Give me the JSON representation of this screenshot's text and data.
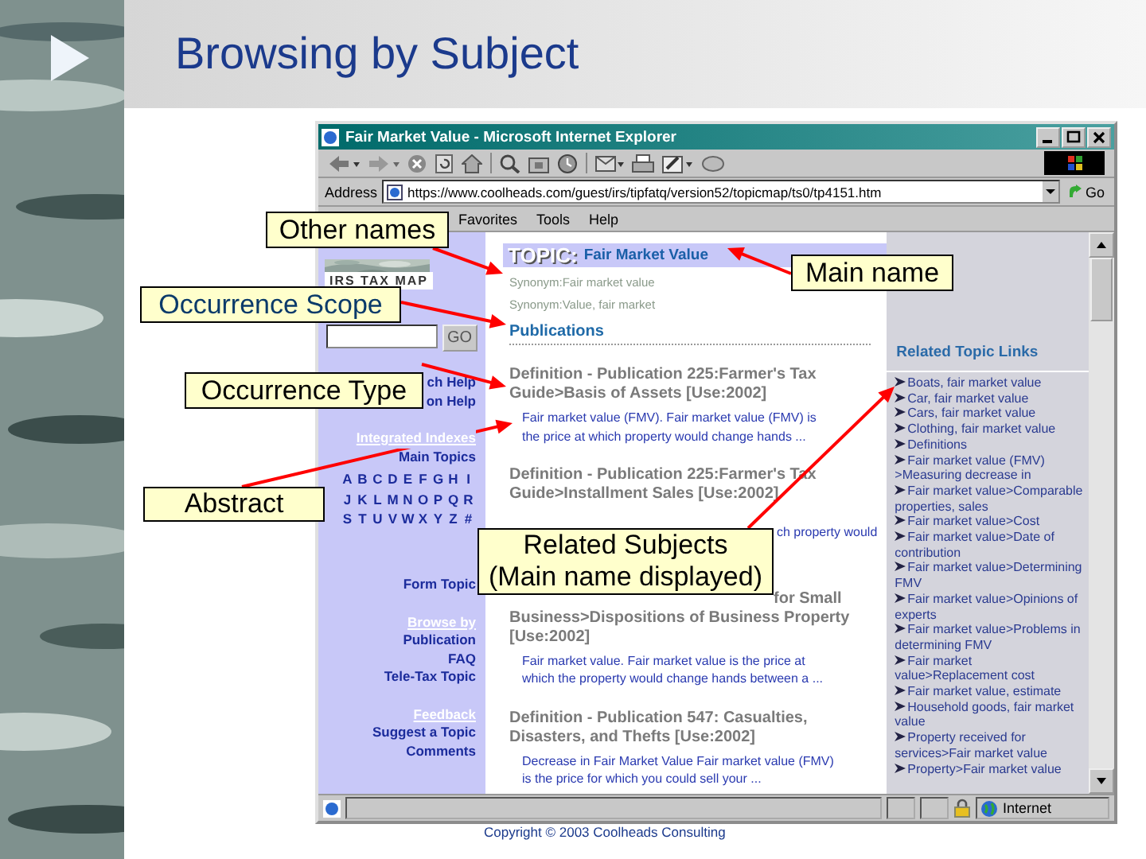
{
  "slide": {
    "title": "Browsing by Subject",
    "copyright": "Copyright © 2003 Coolheads Consulting"
  },
  "browser": {
    "title": "Fair Market Value - Microsoft Internet Explorer",
    "address_label": "Address",
    "url": "https://www.coolheads.com/guest/irs/tipfatq/version52/topicmap/ts0/tp4151.htm",
    "go": "Go",
    "menu": [
      "Favorites",
      "Tools",
      "Help"
    ],
    "status": "Internet"
  },
  "sidebar": {
    "logo_text": "IRS TAX MAP",
    "search_button": "GO",
    "help_links": [
      "ch Help",
      "on Help"
    ],
    "indexes_heading": "Integrated Indexes",
    "main_topics": "Main Topics",
    "letters": [
      "A",
      "B",
      "C",
      "D",
      "E",
      "F",
      "G",
      "H",
      "I",
      "J",
      "K",
      "L",
      "M",
      "N",
      "O",
      "P",
      "Q",
      "R",
      "S",
      "T",
      "U",
      "V",
      "W",
      "X",
      "Y",
      "Z",
      "#"
    ],
    "form_topic": "Form Topic",
    "browse_heading": "Browse by",
    "browse_links": [
      "Publication",
      "FAQ",
      "Tele-Tax Topic"
    ],
    "feedback_heading": "Feedback",
    "feedback_links": [
      "Suggest a Topic",
      "Comments"
    ]
  },
  "topic": {
    "label": "TOPIC:",
    "name": "Fair Market Value",
    "synonyms": [
      "Synonym:Fair market value",
      "Synonym:Value, fair market"
    ],
    "section": "Publications",
    "entries": [
      {
        "title": "Definition - Publication 225:Farmer's Tax Guide>Basis of Assets [Use:2002]",
        "abstract": "Fair market value (FMV). Fair market value (FMV) is the price at which property would change hands ...",
        "kind": "plain"
      },
      {
        "title": "Definition - Publication 225:Farmer's Tax Guide>Installment Sales [Use:2002]",
        "abstract": "ch property would",
        "kind": "partialabstract"
      },
      {
        "title": "for Small Business>Dispositions of Business Property [Use:2002]",
        "abstract": "Fair market value. Fair market value is the price at which the property would change hands between a ...",
        "kind": "partialtitle"
      },
      {
        "title": "Definition - Publication 547: Casualties, Disasters, and Thefts [Use:2002]",
        "abstract": "Decrease in Fair Market Value Fair market value (FMV) is the price for which you could sell your ...",
        "kind": "plain"
      }
    ]
  },
  "related": {
    "heading": "Related Topic Links",
    "links": [
      "Boats, fair market value",
      "Car, fair market value",
      "Cars, fair market value",
      "Clothing, fair market value",
      "Definitions",
      "Fair market value (FMV) >Measuring decrease in",
      "Fair market value>Comparable properties, sales",
      "Fair market value>Cost",
      "Fair market value>Date of contribution",
      "Fair market value>Determining FMV",
      "Fair market value>Opinions of experts",
      "Fair market value>Problems in determining FMV",
      "Fair market value>Replacement cost",
      "Fair market value, estimate",
      "Household goods, fair market value",
      "Property received for services>Fair market value",
      "Property>Fair market value"
    ]
  },
  "callouts": [
    {
      "text": "Other names",
      "color": "#000000"
    },
    {
      "text": "Main name",
      "color": "#000000"
    },
    {
      "text": "Occurrence Scope",
      "color": "#0a3a6a"
    },
    {
      "text": "Occurrence Type",
      "color": "#000000"
    },
    {
      "text": "Abstract",
      "color": "#000000"
    },
    {
      "text": "Related Subjects\n(Main name displayed)",
      "color": "#000000"
    }
  ]
}
